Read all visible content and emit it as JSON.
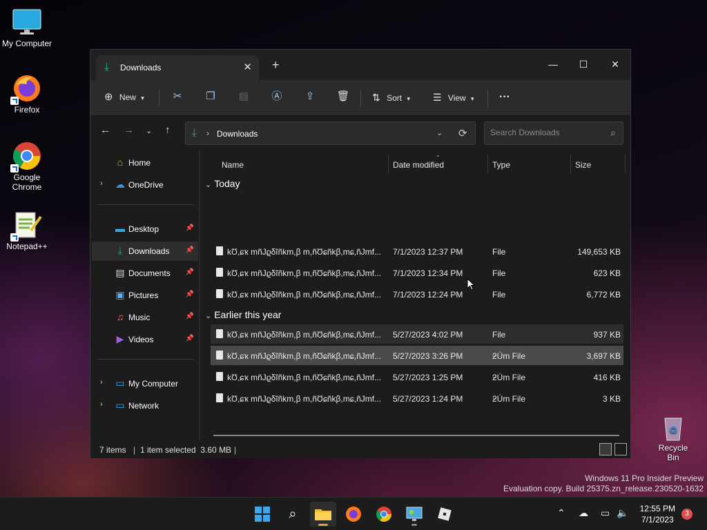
{
  "desktop": {
    "icons": [
      {
        "label": "My Computer",
        "icon": "monitor-icon"
      },
      {
        "label": "Firefox",
        "icon": "firefox-icon"
      },
      {
        "label": "Google Chrome",
        "icon": "chrome-icon"
      },
      {
        "label": "Notepad++",
        "icon": "notepadpp-icon"
      },
      {
        "label": "Recycle Bin",
        "icon": "recycle-bin-icon"
      }
    ],
    "watermark": {
      "line1": "Windows 11 Pro Insider Preview",
      "line2": "Evaluation copy. Build 25375.zn_release.230520-1632"
    }
  },
  "window": {
    "tab_title": "Downloads",
    "new_tab": "+",
    "toolbar": {
      "new_label": "New",
      "sort_label": "Sort",
      "view_label": "View",
      "more_label": "···"
    },
    "address": {
      "path": "Downloads",
      "search_placeholder": "Search Downloads"
    },
    "sidebar": {
      "home": "Home",
      "onedrive": "OneDrive",
      "desktop": "Desktop",
      "downloads": "Downloads",
      "documents": "Documents",
      "pictures": "Pictures",
      "music": "Music",
      "videos": "Videos",
      "my_computer": "My Computer",
      "network": "Network"
    },
    "columns": {
      "name": "Name",
      "date": "Date modified",
      "type": "Type",
      "size": "Size"
    },
    "groups": {
      "today": "Today",
      "earlier": "Earlier this year"
    },
    "files": [
      {
        "name": "kƱ,ɕҡ mñJϱδĩñkm,β m,ñƱɕñkβ,mɕ,ñJmf...",
        "date": "7/1/2023 12:37 PM",
        "type": "File",
        "size": "149,653 KB"
      },
      {
        "name": "kƱ,ɕҡ mñJϱδĩñkm,β m,ñƱɕñkβ,mɕ,ñJmf...",
        "date": "7/1/2023 12:34 PM",
        "type": "File",
        "size": "623 KB"
      },
      {
        "name": "kƱ,ɕҡ mñJϱδĩñkm,β m,ñƱɕñkβ,mɕ,ñJmf...",
        "date": "7/1/2023 12:24 PM",
        "type": "File",
        "size": "6,772 KB"
      },
      {
        "name": "kƱ,ɕҡ mñJϱδĩñkm,β m,ñƱɕñkβ,mɕ,ñJmf...",
        "date": "5/27/2023 4:02 PM",
        "type": "File",
        "size": "937 KB"
      },
      {
        "name": "kƱ,ɕҡ mñJϱδĩñkm,β m,ñƱɕñkβ,mɕ,ñJmf...",
        "date": "5/27/2023 3:26 PM",
        "type": "ƻÚm File",
        "size": "3,697 KB"
      },
      {
        "name": "kƱ,ɕҡ mñJϱδĩñkm,β m,ñƱɕñkβ,mɕ,ñJmf...",
        "date": "5/27/2023 1:25 PM",
        "type": "ƻÚm File",
        "size": "416 KB"
      },
      {
        "name": "kƱ,ɕҡ mñJϱδĩñkm,β m,ñƱɕñkβ,mɕ,ñJmf...",
        "date": "5/27/2023 1:24 PM",
        "type": "ƻÚm File",
        "size": "3 KB"
      }
    ],
    "status": {
      "items": "7 items",
      "selected": "1 item selected  3.60 MB"
    }
  },
  "taskbar": {
    "time": "12:55 PM",
    "date": "7/1/2023",
    "notifications": "3"
  },
  "colors": {
    "accent_green": "#1fb56a",
    "accent_blue": "#9fc7ff",
    "taskbar_bg": "#1c1c1c",
    "window_bg": "#1c1c1c"
  }
}
